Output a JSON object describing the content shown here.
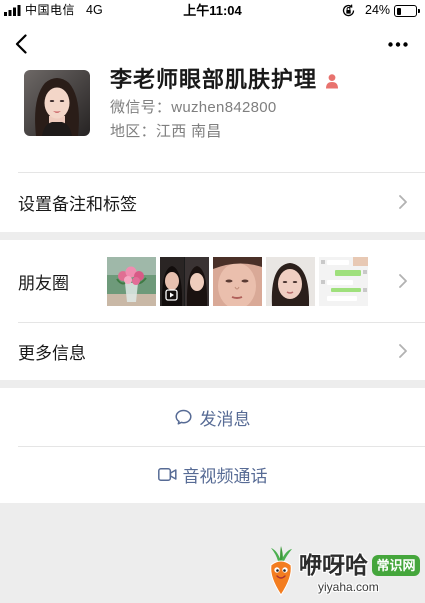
{
  "status_bar": {
    "carrier": "中国电信",
    "network": "4G",
    "time": "上午11:04",
    "battery": "24%",
    "battery_level": 0.24,
    "icons": {
      "signal": "signal-bars-icon",
      "orientation_lock": "orientation-lock-icon",
      "battery": "battery-icon"
    }
  },
  "nav_bar": {
    "back_icon": "chevron-left-icon",
    "more_icon": "more-dots-icon"
  },
  "profile": {
    "name": "李老师眼部肌肤护理",
    "gender_icon": "female-gender-icon",
    "wechat_id_label": "微信号：",
    "wechat_id": "wuzhen842800",
    "region_label": "地区：",
    "region": "江西 南昌"
  },
  "rows": {
    "remarks": {
      "label": "设置备注和标签",
      "icon": "chevron-right-icon"
    },
    "moments": {
      "label": "朋友圈",
      "icon": "chevron-right-icon"
    },
    "more_info": {
      "label": "更多信息",
      "icon": "chevron-right-icon"
    }
  },
  "actions": {
    "send_message": {
      "label": "发消息",
      "icon": "chat-bubble-icon"
    },
    "video_call": {
      "label": "音视频通话",
      "icon": "video-camera-icon"
    }
  },
  "watermark": {
    "brand": "咿呀哈",
    "badge": "常识网",
    "domain": "yiyaha.com",
    "logo_icon": "carrot-logo-icon"
  },
  "colors": {
    "page_bg": "#ededed",
    "card_bg": "#ffffff",
    "text": "#191919",
    "secondary_text": "#7f7f7f",
    "link": "#576b95",
    "chevron": "#b2b2b2",
    "gender_icon": "#e8726e",
    "divider": "#e5e5e5",
    "watermark_badge": "#45a63c"
  }
}
